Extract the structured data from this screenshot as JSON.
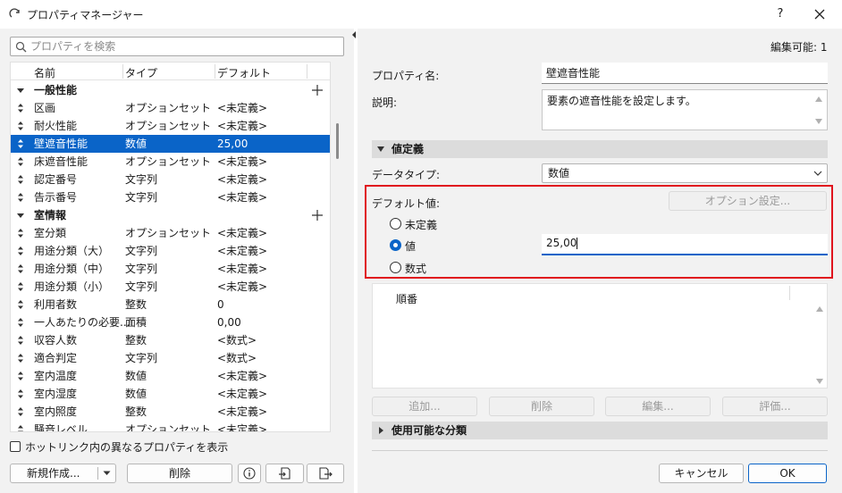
{
  "window": {
    "title": "プロパティマネージャー",
    "help_label": "?"
  },
  "left": {
    "search_placeholder": "プロパティを検索",
    "columns": [
      "名前",
      "タイプ",
      "デフォルト"
    ],
    "rows": [
      {
        "kind": "group",
        "name": "一般性能"
      },
      {
        "kind": "item",
        "name": "区画",
        "type": "オプションセット",
        "default": "<未定義>"
      },
      {
        "kind": "item",
        "name": "耐火性能",
        "type": "オプションセット",
        "default": "<未定義>"
      },
      {
        "kind": "item",
        "name": "壁遮音性能",
        "type": "数値",
        "default": "25,00",
        "selected": true
      },
      {
        "kind": "item",
        "name": "床遮音性能",
        "type": "オプションセット",
        "default": "<未定義>"
      },
      {
        "kind": "item",
        "name": "認定番号",
        "type": "文字列",
        "default": "<未定義>"
      },
      {
        "kind": "item",
        "name": "告示番号",
        "type": "文字列",
        "default": "<未定義>"
      },
      {
        "kind": "group",
        "name": "室情報"
      },
      {
        "kind": "item",
        "name": "室分類",
        "type": "オプションセット",
        "default": "<未定義>"
      },
      {
        "kind": "item",
        "name": "用途分類（大）",
        "type": "文字列",
        "default": "<未定義>"
      },
      {
        "kind": "item",
        "name": "用途分類（中）",
        "type": "文字列",
        "default": "<未定義>"
      },
      {
        "kind": "item",
        "name": "用途分類（小）",
        "type": "文字列",
        "default": "<未定義>"
      },
      {
        "kind": "item",
        "name": "利用者数",
        "type": "整数",
        "default": "0"
      },
      {
        "kind": "item",
        "name": "一人あたりの必要...",
        "type": "面積",
        "default": "0,00"
      },
      {
        "kind": "item",
        "name": "収容人数",
        "type": "整数",
        "default": "<数式>"
      },
      {
        "kind": "item",
        "name": "適合判定",
        "type": "文字列",
        "default": "<数式>"
      },
      {
        "kind": "item",
        "name": "室内温度",
        "type": "数値",
        "default": "<未定義>"
      },
      {
        "kind": "item",
        "name": "室内湿度",
        "type": "数値",
        "default": "<未定義>"
      },
      {
        "kind": "item",
        "name": "室内照度",
        "type": "整数",
        "default": "<未定義>"
      },
      {
        "kind": "item",
        "name": "騒音レベル",
        "type": "オプションセット",
        "default": "<未定義>"
      }
    ],
    "hotlink_checkbox_label": "ホットリンク内の異なるプロパティを表示",
    "new_button": "新規作成...",
    "delete_button": "削除"
  },
  "right": {
    "editable_label": "編集可能: 1",
    "property_name_label": "プロパティ名:",
    "property_name_value": "壁遮音性能",
    "description_label": "説明:",
    "description_value": "要素の遮音性能を設定します。",
    "value_definition_section": "値定義",
    "data_type_label": "データタイプ:",
    "data_type_value": "数値",
    "default_value_label": "デフォルト値:",
    "option_settings_button": "オプション設定...",
    "radio_undefined": "未定義",
    "radio_value": "値",
    "radio_formula": "数式",
    "value_input": "25,00",
    "order_header": "順番",
    "add_button": "追加...",
    "delete_button": "削除",
    "edit_button": "編集...",
    "evaluate_button": "評価...",
    "available_classification_section": "使用可能な分類",
    "cancel_button": "キャンセル",
    "ok_button": "OK"
  }
}
